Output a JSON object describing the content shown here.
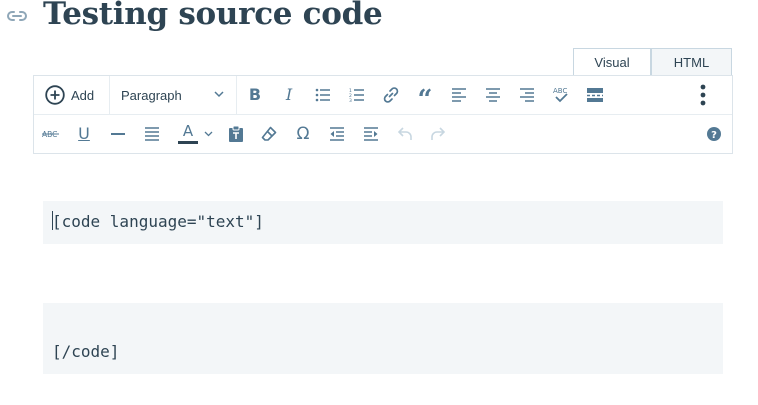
{
  "post": {
    "title": "Testing source code"
  },
  "mode_tabs": {
    "visual": "Visual",
    "html": "HTML"
  },
  "toolbar": {
    "add_label": "Add",
    "format_value": "Paragraph",
    "row1_buttons": [
      "bold",
      "italic",
      "bulleted-list",
      "numbered-list",
      "link",
      "blockquote",
      "align-left",
      "align-center",
      "align-right",
      "spellcheck",
      "read-more",
      "more-options"
    ],
    "row2_buttons": [
      "strikethrough",
      "underline",
      "horizontal-line",
      "justify",
      "text-color",
      "paste-as-text",
      "clear-formatting",
      "special-character",
      "decrease-indent",
      "increase-indent",
      "undo",
      "redo",
      "help"
    ],
    "text_color_accent": "#2e4453"
  },
  "content": {
    "block1": "[code language=\"text\"]",
    "block2": "[/code]"
  },
  "colors": {
    "text": "#2e4453",
    "icon": "#537994",
    "border": "#dce4ea",
    "block_bg": "#f3f6f8",
    "disabled": "#c8d7e1"
  }
}
